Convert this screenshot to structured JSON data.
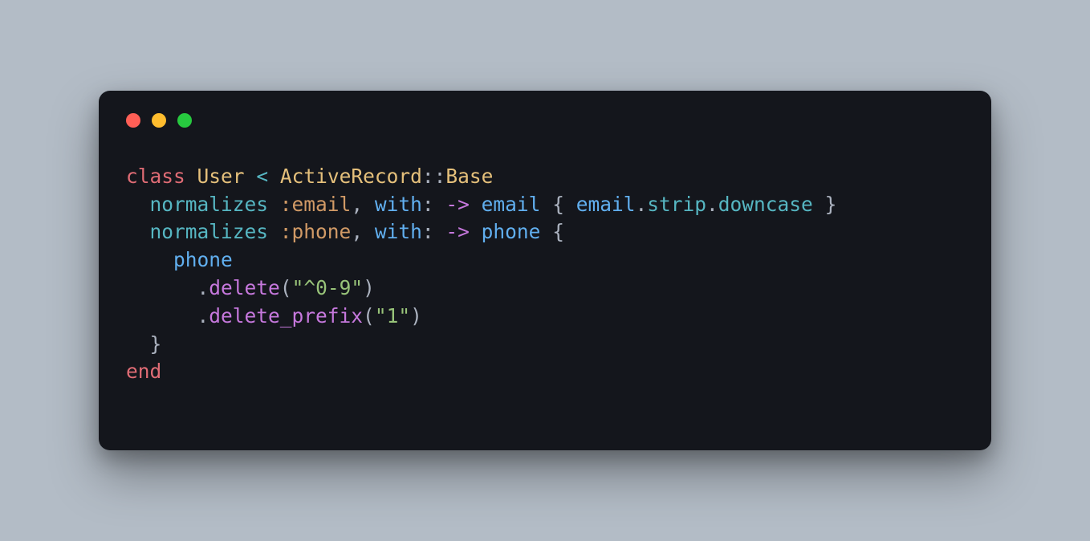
{
  "window": {
    "traffic_lights": [
      "close",
      "minimize",
      "zoom"
    ]
  },
  "code": {
    "kw_class": "class",
    "cls_user": "User",
    "op_inherit": "<",
    "cls_ar": "ActiveRecord",
    "scope": "::",
    "cls_base": "Base",
    "m_normalizes": "normalizes",
    "sym_email": ":email",
    "comma": ",",
    "kw_with": "with",
    "colon": ":",
    "arrow": "->",
    "param_email": "email",
    "brace_open": "{",
    "brace_close": "}",
    "dot": ".",
    "m_strip": "strip",
    "m_downcase": "downcase",
    "sym_phone": ":phone",
    "param_phone": "phone",
    "m_delete": "delete",
    "paren_open": "(",
    "paren_close": ")",
    "str_digits": "\"^0-9\"",
    "m_delete_prefix": "delete_prefix",
    "str_one": "\"1\"",
    "kw_end": "end"
  }
}
